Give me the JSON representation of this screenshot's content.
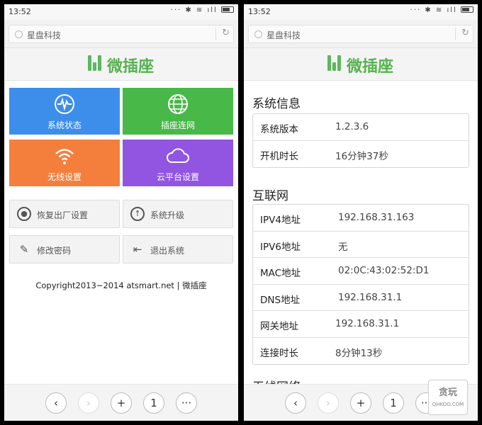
{
  "left": {
    "status": {
      "time": "13:52",
      "icons": "··· ✱ ≋ ıll"
    },
    "url": {
      "text": "星盘科技",
      "reload_icon": "refresh-icon"
    },
    "brand": {
      "name": "微插座",
      "color": "#55b24e"
    },
    "tiles": [
      {
        "label": "系统状态",
        "icon": "pulse-icon",
        "color": "#3d8eea"
      },
      {
        "label": "插座连网",
        "icon": "globe-icon",
        "color": "#48b849"
      },
      {
        "label": "无线设置",
        "icon": "wifi-icon",
        "color": "#f47f3c"
      },
      {
        "label": "云平台设置",
        "icon": "cloud-icon",
        "color": "#9155e2"
      }
    ],
    "actions": [
      {
        "label": "恢复出厂设置",
        "icon": "restore-icon"
      },
      {
        "label": "系统升级",
        "icon": "upgrade-icon"
      },
      {
        "label": "修改密码",
        "icon": "edit-icon"
      },
      {
        "label": "退出系统",
        "icon": "logout-icon"
      }
    ],
    "copyright": "Copyright2013~2014 atsmart.net | 微插座",
    "nav": {
      "tab_count": "1"
    }
  },
  "right": {
    "status": {
      "time": "13:52",
      "icons": "··· ✱ ≋ ıll"
    },
    "url": {
      "text": "星盘科技"
    },
    "brand": {
      "name": "微插座"
    },
    "sections": [
      {
        "title": "系统信息",
        "rows": [
          {
            "key": "系统版本",
            "value": "1.2.3.6"
          },
          {
            "key": "开机时长",
            "value": "16分钟37秒"
          }
        ]
      },
      {
        "title": "互联网",
        "rows": [
          {
            "key": "IPV4地址",
            "value": "192.168.31.163"
          },
          {
            "key": "IPV6地址",
            "value": "无"
          },
          {
            "key": "MAC地址",
            "value": "02:0C:43:02:52:D1"
          },
          {
            "key": "DNS地址",
            "value": "192.168.31.1"
          },
          {
            "key": "网关地址",
            "value": "192.168.31.1"
          },
          {
            "key": "连接时长",
            "value": "8分钟13秒"
          }
        ]
      },
      {
        "title": "无线网络"
      }
    ],
    "nav": {
      "tab_count": "1"
    },
    "watermark": {
      "top": "贪玩",
      "bottom": "QHKOO.COM"
    }
  }
}
